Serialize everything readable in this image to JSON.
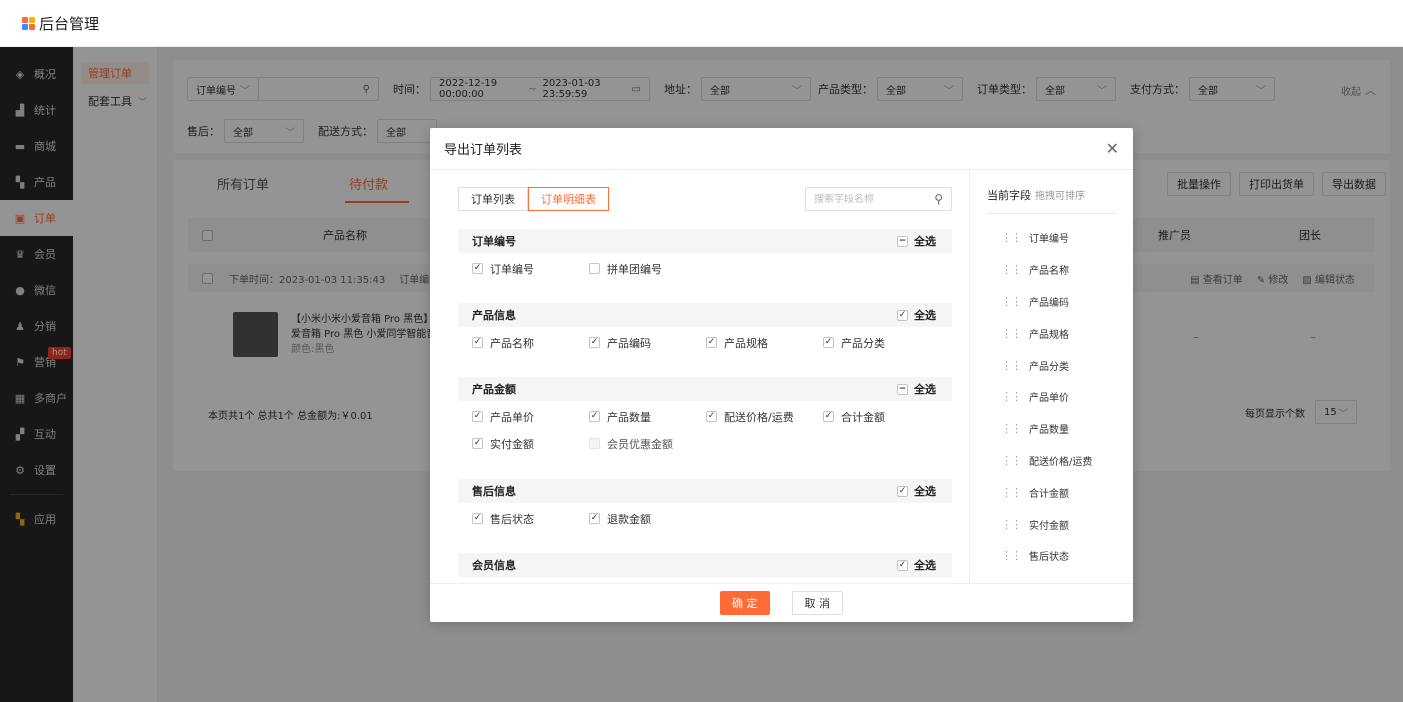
{
  "app": {
    "brand": "后台管理",
    "logo_colors": [
      "#ff6b36",
      "#ffb400",
      "#3a8dff",
      "#ff6b36"
    ]
  },
  "sidebar": {
    "items": [
      {
        "label": "概况",
        "icon": "layers-icon"
      },
      {
        "label": "统计",
        "icon": "chart-icon"
      },
      {
        "label": "商城",
        "icon": "store-icon"
      },
      {
        "label": "产品",
        "icon": "grid-icon"
      },
      {
        "label": "订单",
        "icon": "clipboard-icon",
        "active": true
      },
      {
        "label": "会员",
        "icon": "crown-icon"
      },
      {
        "label": "微信",
        "icon": "wechat-icon"
      },
      {
        "label": "分销",
        "icon": "users-icon"
      },
      {
        "label": "营销",
        "icon": "flag-icon",
        "badge": "hot"
      },
      {
        "label": "多商户",
        "icon": "shop-icon"
      },
      {
        "label": "互动",
        "icon": "apps-icon"
      },
      {
        "label": "设置",
        "icon": "gear-icon"
      },
      {
        "label": "应用",
        "icon": "color-grid-icon"
      }
    ]
  },
  "subsidebar": {
    "items": [
      {
        "label": "管理订单",
        "active": true
      },
      {
        "label": "配套工具",
        "has_children": true
      }
    ]
  },
  "filters": {
    "order_no_select": "订单编号",
    "time_label": "时间：",
    "time_start": "2022-12-19 00:00:00",
    "time_sep": "~",
    "time_end": "2023-01-03 23:59:59",
    "address_label": "地址：",
    "address_value": "全部",
    "product_type_label": "产品类型：",
    "product_type_value": "全部",
    "order_type_label": "订单类型：",
    "order_type_value": "全部",
    "pay_label": "支付方式：",
    "pay_value": "全部",
    "collapse": "收起",
    "after_sale_label": "售后：",
    "after_sale_value": "全部",
    "delivery_label": "配送方式：",
    "delivery_value": "全部"
  },
  "list": {
    "tabs": [
      "所有订单",
      "待付款"
    ],
    "active_tab": "待付款",
    "actions": [
      "批量操作",
      "打印出货单",
      "导出数据"
    ],
    "columns": [
      "产品名称",
      "推广员",
      "团长"
    ],
    "order_time": "下单时间：2023-01-03 11:35:43",
    "order_no_prefix": "订单编",
    "row_actions": [
      "查看订单",
      "修改",
      "编辑状态"
    ],
    "product_title_1": "【小米小米小爱音箱 Pro 黑色】/",
    "product_title_2": "爱音箱 Pro 黑色 小爱同学智能音",
    "product_spec": "颜色:黑色",
    "promoter": "–",
    "leader": "–",
    "summary": "本页共1个  总共1个  总金额为:￥0.01",
    "page_size_label": "每页显示个数",
    "page_size": "15"
  },
  "dialog": {
    "title": "导出订单列表",
    "seg_tabs": [
      "订单列表",
      "订单明细表"
    ],
    "seg_active": "订单明细表",
    "search_placeholder": "搜索字段名称",
    "groups": [
      {
        "title": "订单编号",
        "selall_state": "partial",
        "selall_label": "全选",
        "items": [
          {
            "label": "订单编号",
            "checked": true
          },
          {
            "label": "拼单团编号",
            "checked": false
          }
        ]
      },
      {
        "title": "产品信息",
        "selall_state": "checked",
        "selall_label": "全选",
        "items": [
          {
            "label": "产品名称",
            "checked": true
          },
          {
            "label": "产品编码",
            "checked": true
          },
          {
            "label": "产品规格",
            "checked": true
          },
          {
            "label": "产品分类",
            "checked": true
          }
        ]
      },
      {
        "title": "产品金额",
        "selall_state": "partial",
        "selall_label": "全选",
        "items": [
          {
            "label": "产品单价",
            "checked": true
          },
          {
            "label": "产品数量",
            "checked": true
          },
          {
            "label": "配送价格/运费",
            "checked": true
          },
          {
            "label": "合计金额",
            "checked": true
          },
          {
            "label": "实付金额",
            "checked": true
          },
          {
            "label": "会员优惠金额",
            "checked": false,
            "disabled": true
          }
        ]
      },
      {
        "title": "售后信息",
        "selall_state": "checked",
        "selall_label": "全选",
        "items": [
          {
            "label": "售后状态",
            "checked": true
          },
          {
            "label": "退款金额",
            "checked": true
          }
        ]
      },
      {
        "title": "会员信息",
        "selall_state": "checked",
        "selall_label": "全选",
        "items": []
      }
    ],
    "current_fields_title": "当前字段",
    "current_fields_hint": "拖拽可排序",
    "current_fields": [
      "订单编号",
      "产品名称",
      "产品编码",
      "产品规格",
      "产品分类",
      "产品单价",
      "产品数量",
      "配送价格/运费",
      "合计金额",
      "实付金额",
      "售后状态"
    ],
    "confirm": "确 定",
    "cancel": "取 消"
  }
}
